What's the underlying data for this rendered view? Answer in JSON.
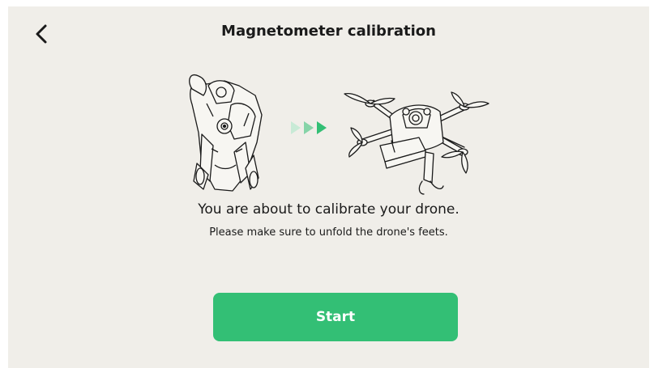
{
  "header": {
    "title": "Magnetometer calibration",
    "back_icon": "chevron-left-icon"
  },
  "illustration": {
    "folded_drone": "folded-drone-illustration",
    "unfolded_drone": "unfolded-drone-illustration",
    "arrows_icon": "triple-chevron-right-icon"
  },
  "message": {
    "headline": "You are about to calibrate your drone.",
    "instruction": "Please make sure to unfold the drone's feets."
  },
  "actions": {
    "start_label": "Start"
  },
  "colors": {
    "background": "#f0eee9",
    "accent": "#33bf75",
    "text": "#1a1a1a"
  }
}
